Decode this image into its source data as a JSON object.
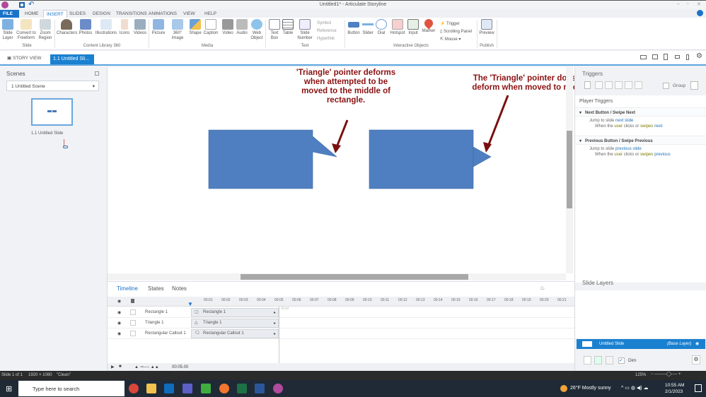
{
  "window": {
    "title": "Untitled1* - Articulate Storyline"
  },
  "menu_tabs": [
    "FILE",
    "HOME",
    "INSERT",
    "SLIDES",
    "DESIGN",
    "TRANSITIONS",
    "ANIMATIONS",
    "VIEW",
    "HELP"
  ],
  "ribbon": {
    "slide": {
      "items": [
        "Slide Layer",
        "Convert to Freeform",
        "Zoom Region"
      ],
      "group": "Slide"
    },
    "content_library": {
      "items": [
        "Characters",
        "Photos",
        "Illustrations",
        "Icons",
        "Videos"
      ],
      "group": "Content Library 360"
    },
    "media": {
      "items": [
        "Picture",
        "360° Image",
        "Shape",
        "Caption",
        "Video",
        "Audio",
        "Web Object"
      ],
      "group": "Media"
    },
    "text": {
      "items": [
        "Text Box",
        "Table",
        "Slide Number"
      ],
      "small": [
        "Symbol",
        "Reference",
        "Hyperlink"
      ],
      "group": "Text"
    },
    "interactive": {
      "items": [
        "Button",
        "Slider",
        "Dial",
        "Hotspot",
        "Input",
        "Marker"
      ],
      "small": [
        "Trigger",
        "Scrolling Panel",
        "Mouse"
      ],
      "group": "Interactive Objects"
    },
    "publish": {
      "items": [
        "Preview"
      ],
      "group": "Publish"
    }
  },
  "view_tabs": {
    "story_view": "STORY VIEW",
    "slide_tab": "1.1 Untitled Sli..."
  },
  "scenes": {
    "title": "Scenes",
    "selected_scene": "1 Untitled Scene",
    "slide_label": "1.1 Untitled Slide"
  },
  "annotations": {
    "left": "'Triangle' pointer deforms when attempted to be moved to the middle of rectangle.",
    "right": "The 'Triangle' pointer does not deform when moved to middle."
  },
  "triggers": {
    "title": "Triggers",
    "group_label": "Group",
    "player_triggers": "Player Triggers",
    "items": [
      {
        "header": "Next Button / Swipe Next",
        "action": "Jump to slide",
        "target": "next slide",
        "when": "When the",
        "user": "user",
        "verb": "clicks or",
        "swipes": "swipes",
        "obj": "next"
      },
      {
        "header": "Previous Button / Swipe Previous",
        "action": "Jump to slide",
        "target": "previous slide",
        "when": "When the",
        "user": "user",
        "verb": "clicks or",
        "swipes": "swipes",
        "obj": "previous"
      }
    ]
  },
  "timeline": {
    "tabs": [
      "Timeline",
      "States",
      "Notes"
    ],
    "ticks": [
      "00:01",
      "00:02",
      "00:03",
      "00:04",
      "00:05",
      "00:06",
      "00:07",
      "00:08",
      "00:09",
      "00:10",
      "00:11",
      "00:12",
      "00:13",
      "00:14",
      "00:15",
      "00:16",
      "00:17",
      "00:18",
      "00:19",
      "00:20",
      "00:21"
    ],
    "end_label": "End",
    "rows": [
      "Rectangle 1",
      "Triangle 1",
      "Rectangular Callout 1"
    ],
    "duration": "00:05.00"
  },
  "slide_layers": {
    "title": "Slide Layers",
    "layer_name": "Untitled Slide",
    "layer_type": "(Base Layer)",
    "dim_label": "Dim"
  },
  "status": {
    "slide": "Slide 1 of 1",
    "size": "1920 × 1080",
    "theme": "\"Clean\"",
    "zoom": "125%"
  },
  "taskbar": {
    "search_placeholder": "Type here to search",
    "weather": "26°F  Mostly sunny",
    "time": "10:55 AM",
    "date": "2/1/2023"
  }
}
